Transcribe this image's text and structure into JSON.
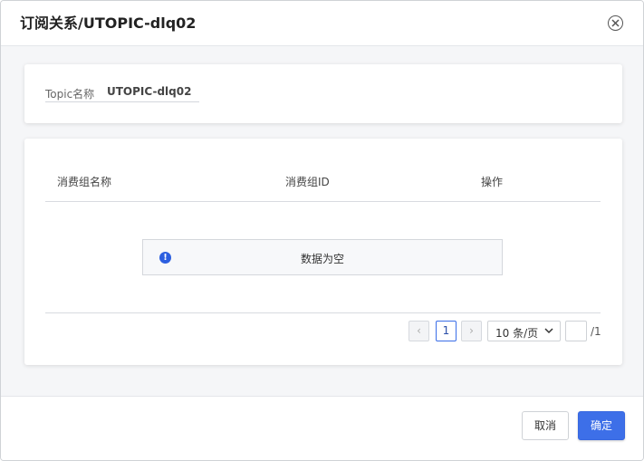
{
  "dialog": {
    "title": "订阅关系/UTOPIC-dlq02"
  },
  "topic": {
    "label": "Topic名称",
    "value": "UTOPIC-dlq02"
  },
  "table": {
    "columns": [
      "消费组名称",
      "消费组ID",
      "操作"
    ],
    "empty_text": "数据为空"
  },
  "pagination": {
    "prev": "‹",
    "next": "›",
    "current_page": "1",
    "page_size": "10 条/页",
    "jump_value": "",
    "total_pages": "/1"
  },
  "footer": {
    "cancel_label": "取消",
    "ok_label": "确定"
  },
  "colors": {
    "primary": "#3d6fe8",
    "info_icon": "#2c5fe0",
    "body_bg": "#f5f6f8"
  }
}
